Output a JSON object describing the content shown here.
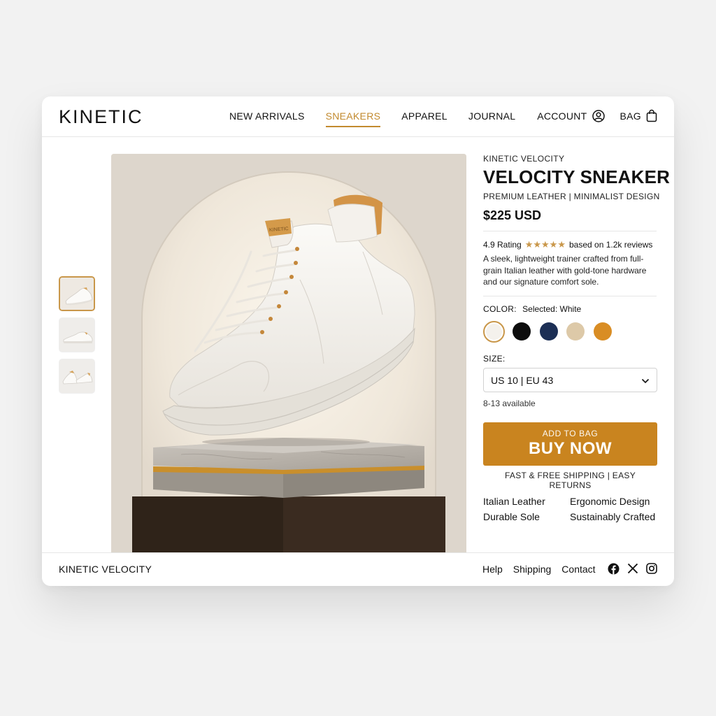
{
  "header": {
    "logo": "KINETIC",
    "nav": [
      "NEW ARRIVALS",
      "SNEAKERS",
      "APPAREL",
      "JOURNAL"
    ],
    "active_nav": "SNEAKERS",
    "account_label": "ACCOUNT",
    "bag_label": "BAG"
  },
  "product": {
    "brand": "KINETIC VELOCITY",
    "title": "VELOCITY SNEAKER",
    "subtitle": "PREMIUM LEATHER | MINIMALIST DESIGN",
    "price": "$225 USD",
    "rating_label": "4.9 Rating",
    "rating": 4.9,
    "stars": "★★★★★",
    "reviews": "based on 1.2k reviews",
    "description": "A sleek, lightweight trainer crafted from full-grain Italian leather with gold-tone hardware and our signature comfort sole.",
    "color_label": "COLOR:",
    "color_selected": "Selected: White",
    "colors": [
      "#f4f1ec",
      "#0d0d0d",
      "#1c2f55",
      "#ddc9a8",
      "#d98d24"
    ],
    "size_label": "SIZE:",
    "size_value": "US 10 | EU 43",
    "availability": "8-13 available",
    "cta_small": "ADD TO BAG",
    "cta_big": "BUY NOW",
    "shipping": "FAST & FREE SHIPPING | EASY RETURNS",
    "features": [
      "Italian Leather",
      "Ergonomic Design",
      "Durable Sole",
      "Sustainably Crafted"
    ]
  },
  "footer": {
    "brand": "KINETIC VELOCITY",
    "links": [
      "Help",
      "Shipping",
      "Contact"
    ]
  },
  "icons": {
    "account": "user-circle-icon",
    "bag": "shopping-bag-icon",
    "select": "chevron-down-icon",
    "social": [
      "facebook-icon",
      "x-icon",
      "instagram-icon"
    ]
  },
  "accent_color": "#c9841f"
}
